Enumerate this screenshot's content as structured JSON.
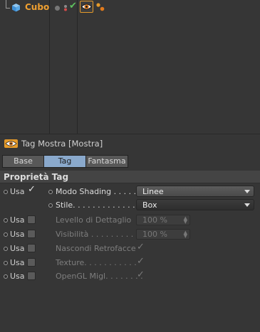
{
  "object_manager": {
    "object_name": "Cubo",
    "icons": [
      "cube-icon",
      "visibility-dot-icon",
      "layer-dots-icon",
      "enabled-check-icon",
      "display-tag-eye-icon",
      "material-dots-icon"
    ],
    "colors": {
      "object_name": "#f0a030",
      "check": "#5ec05e",
      "tag_highlight": "#e49a2a"
    }
  },
  "attribute_manager": {
    "title": "Tag Mostra [Mostra]",
    "tabs": [
      {
        "label": "Base",
        "active": false
      },
      {
        "label": "Tag",
        "active": true
      },
      {
        "label": "Fantasma",
        "active": false
      }
    ],
    "section_title": "Proprietà Tag",
    "use_label": "Usa",
    "params": [
      {
        "label": "Modo Shading . . . . .",
        "use_checked": true,
        "value": "Linee",
        "type": "dropdown",
        "enabled": true
      },
      {
        "label": "Stile. . . . . . . . . . . . .",
        "use_checked": true,
        "value": "Box",
        "type": "dropdown",
        "enabled": true
      },
      {
        "label": "Levello di Dettaglio",
        "use_checked": false,
        "value": "100 %",
        "type": "number",
        "enabled": false
      },
      {
        "label": "Visibilità . . . . . . . . . .",
        "use_checked": false,
        "value": "100 %",
        "type": "number",
        "enabled": false
      },
      {
        "label": "Nascondi Retrofacce",
        "use_checked": false,
        "value": "✓",
        "type": "check",
        "enabled": false
      },
      {
        "label": "Texture. . . . . . . . . . .",
        "use_checked": false,
        "value": "✓",
        "type": "check",
        "enabled": false
      },
      {
        "label": "OpenGL Migl. . . . . . . .",
        "use_checked": false,
        "value": "✓",
        "type": "check",
        "enabled": false
      }
    ],
    "colors": {
      "active_tab": "#8aa9cc",
      "panel_bg": "#363636"
    }
  }
}
